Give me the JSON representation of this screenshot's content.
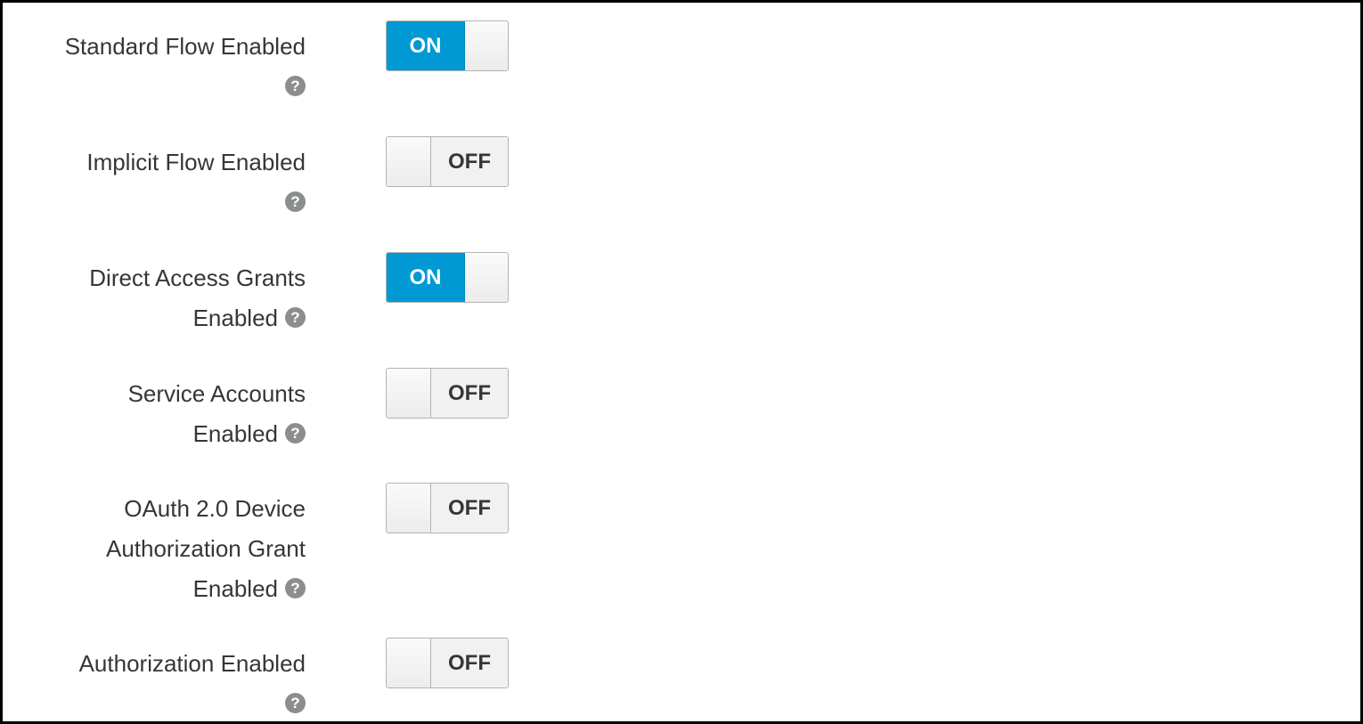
{
  "settings": [
    {
      "label_lines": [
        "Standard Flow Enabled"
      ],
      "help_icon": "question-circle-icon",
      "toggle": {
        "checked": true,
        "text": "ON"
      }
    },
    {
      "label_lines": [
        "Implicit Flow Enabled"
      ],
      "help_icon": "question-circle-icon",
      "toggle": {
        "checked": false,
        "text": "OFF"
      }
    },
    {
      "label_lines": [
        "Direct Access Grants",
        "Enabled"
      ],
      "help_icon": "question-circle-icon",
      "toggle": {
        "checked": true,
        "text": "ON"
      }
    },
    {
      "label_lines": [
        "Service Accounts",
        "Enabled"
      ],
      "help_icon": "question-circle-icon",
      "toggle": {
        "checked": false,
        "text": "OFF"
      }
    },
    {
      "label_lines": [
        "OAuth 2.0 Device",
        "Authorization Grant",
        "Enabled"
      ],
      "help_icon": "question-circle-icon",
      "toggle": {
        "checked": false,
        "text": "OFF"
      }
    },
    {
      "label_lines": [
        "Authorization Enabled"
      ],
      "help_icon": "question-circle-icon",
      "toggle": {
        "checked": false,
        "text": "OFF"
      }
    }
  ],
  "colors": {
    "on_background": "#0099d3",
    "off_background": "#f1f1f1",
    "label_text": "#363636",
    "help_icon": "#8b8d8f"
  }
}
